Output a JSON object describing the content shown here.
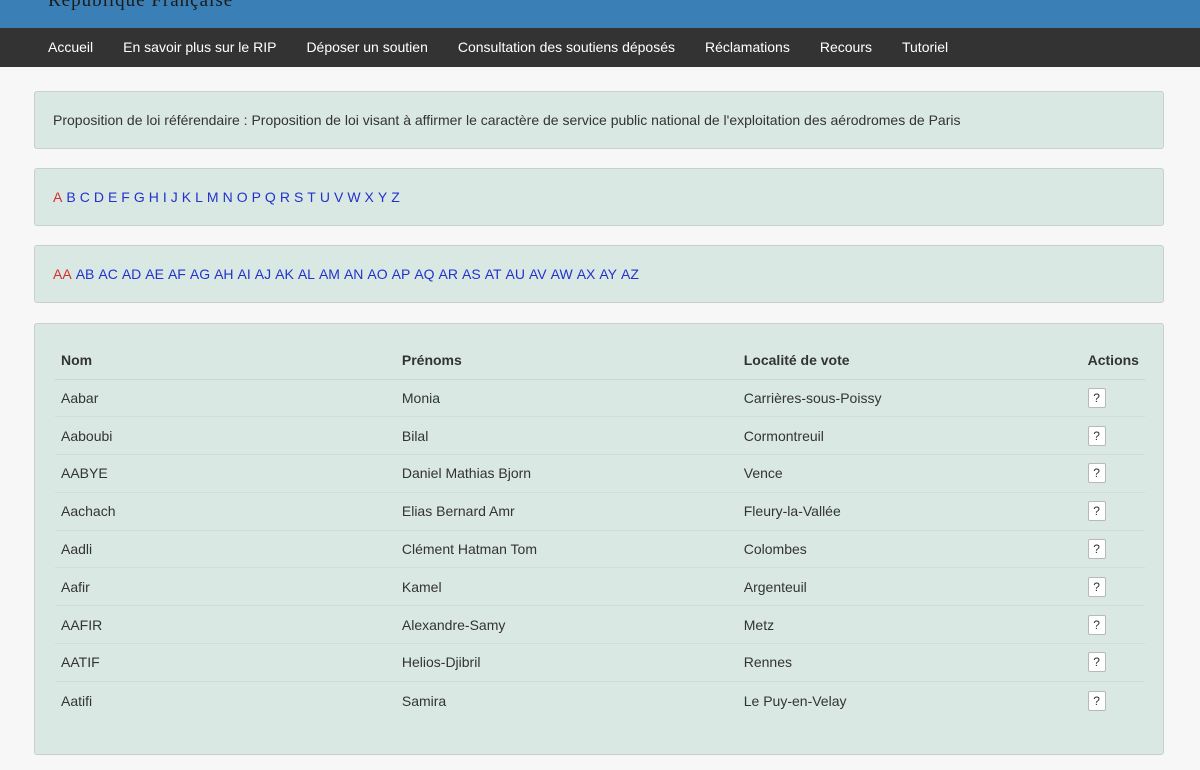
{
  "banner": {
    "title": "République Française"
  },
  "nav": {
    "items": [
      {
        "label": "Accueil"
      },
      {
        "label": "En savoir plus sur le RIP"
      },
      {
        "label": "Déposer un soutien"
      },
      {
        "label": "Consultation des soutiens déposés"
      },
      {
        "label": "Réclamations"
      },
      {
        "label": "Recours"
      },
      {
        "label": "Tutoriel"
      }
    ]
  },
  "proposition": {
    "text": "Proposition de loi référendaire : Proposition de loi visant à affirmer le caractère de service public national de l'exploitation des aérodromes de Paris"
  },
  "letters": [
    "A",
    "B",
    "C",
    "D",
    "E",
    "F",
    "G",
    "H",
    "I",
    "J",
    "K",
    "L",
    "M",
    "N",
    "O",
    "P",
    "Q",
    "R",
    "S",
    "T",
    "U",
    "V",
    "W",
    "X",
    "Y",
    "Z"
  ],
  "letters_active": "A",
  "pairs": [
    "AA",
    "AB",
    "AC",
    "AD",
    "AE",
    "AF",
    "AG",
    "AH",
    "AI",
    "AJ",
    "AK",
    "AL",
    "AM",
    "AN",
    "AO",
    "AP",
    "AQ",
    "AR",
    "AS",
    "AT",
    "AU",
    "AV",
    "AW",
    "AX",
    "AY",
    "AZ"
  ],
  "pairs_active": "AA",
  "colors": {
    "active_link": "#d32f2f",
    "link": "#2233cc",
    "panel_bg": "#dae8e3",
    "navbar_bg": "#333333",
    "banner_bg": "#3a7fb5"
  },
  "table": {
    "headers": {
      "nom": "Nom",
      "prenoms": "Prénoms",
      "localite": "Localité de vote",
      "actions": "Actions"
    },
    "action_label": "?",
    "rows": [
      {
        "nom": "Aabar",
        "prenoms": "Monia",
        "localite": "Carrières-sous-Poissy"
      },
      {
        "nom": "Aaboubi",
        "prenoms": "Bilal",
        "localite": "Cormontreuil"
      },
      {
        "nom": "AABYE",
        "prenoms": "Daniel Mathias Bjorn",
        "localite": "Vence"
      },
      {
        "nom": "Aachach",
        "prenoms": "Elias Bernard Amr",
        "localite": "Fleury-la-Vallée"
      },
      {
        "nom": "Aadli",
        "prenoms": "Clément Hatman Tom",
        "localite": "Colombes"
      },
      {
        "nom": "Aafir",
        "prenoms": "Kamel",
        "localite": "Argenteuil"
      },
      {
        "nom": "AAFIR",
        "prenoms": "Alexandre-Samy",
        "localite": "Metz"
      },
      {
        "nom": "AATIF",
        "prenoms": "Helios-Djibril",
        "localite": "Rennes"
      },
      {
        "nom": "Aatifi",
        "prenoms": "Samira",
        "localite": "Le Puy-en-Velay"
      }
    ]
  }
}
